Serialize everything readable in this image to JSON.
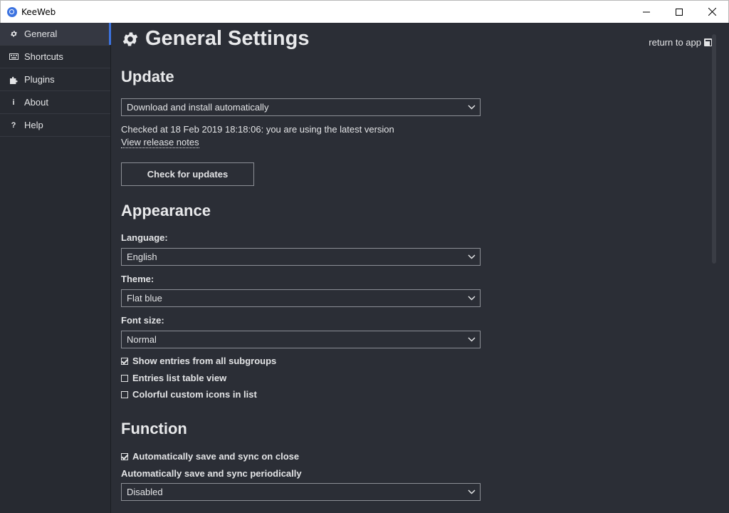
{
  "window": {
    "title": "KeeWeb"
  },
  "sidebar": {
    "items": [
      {
        "label": "General",
        "icon": "gear-icon"
      },
      {
        "label": "Shortcuts",
        "icon": "keyboard-icon"
      },
      {
        "label": "Plugins",
        "icon": "puzzle-icon"
      },
      {
        "label": "About",
        "icon": "info-icon"
      },
      {
        "label": "Help",
        "icon": "question-icon"
      }
    ],
    "active_index": 0
  },
  "header": {
    "title": "General Settings",
    "return_link": "return to app"
  },
  "update": {
    "heading": "Update",
    "select_value": "Download and install automatically",
    "status": "Checked at 18 Feb 2019 18:18:06: you are using the latest version",
    "release_notes_link": "View release notes",
    "check_button": "Check for updates"
  },
  "appearance": {
    "heading": "Appearance",
    "language_label": "Language:",
    "language_value": "English",
    "theme_label": "Theme:",
    "theme_value": "Flat blue",
    "font_size_label": "Font size:",
    "font_size_value": "Normal",
    "checkboxes": [
      {
        "label": "Show entries from all subgroups",
        "checked": true
      },
      {
        "label": "Entries list table view",
        "checked": false
      },
      {
        "label": "Colorful custom icons in list",
        "checked": false
      }
    ]
  },
  "function": {
    "heading": "Function",
    "autosave_close_label": "Automatically save and sync on close",
    "autosave_close_checked": true,
    "autosave_periodic_label": "Automatically save and sync periodically",
    "autosave_periodic_value": "Disabled"
  },
  "colors": {
    "accent": "#3c73e0",
    "background": "#2b2e36",
    "sidebar": "#272a31"
  }
}
